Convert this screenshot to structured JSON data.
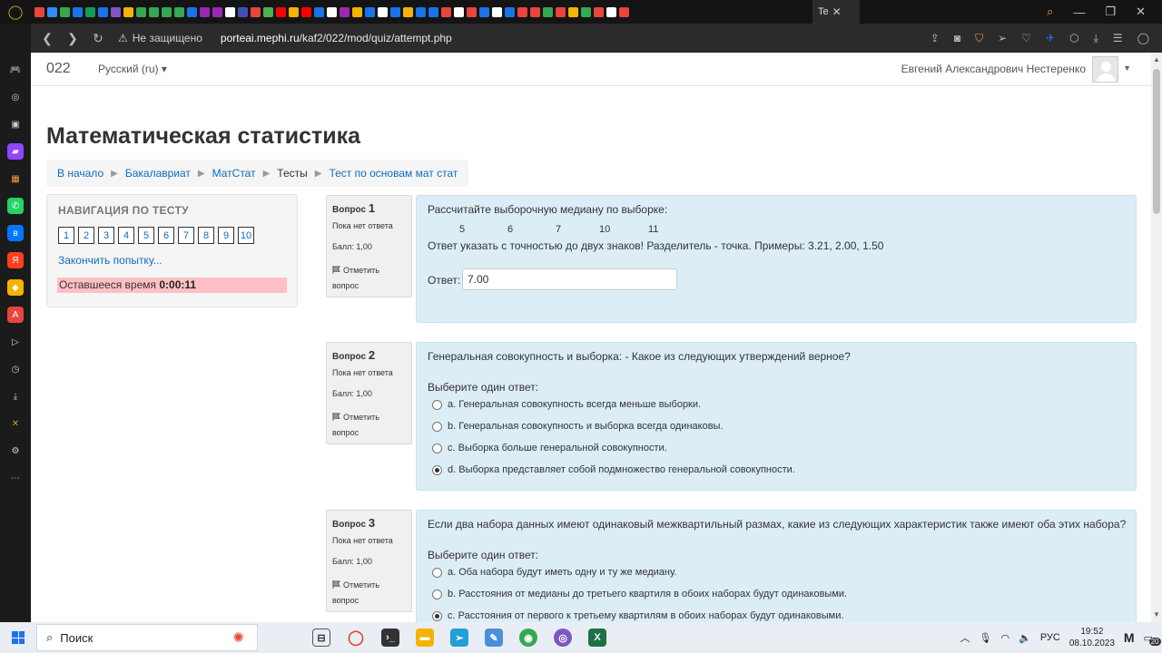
{
  "browser": {
    "active_tab_title": "Te",
    "security_label": "Не защищено",
    "url_host": "porteai.mephi.ru",
    "url_path": "/kaf2/022/mod/quiz/attempt.php"
  },
  "site": {
    "brand": "022",
    "language": "Русский ‎(ru)‎",
    "user_name": "Евгений Александрович Нестеренко"
  },
  "page": {
    "title": "Математическая статистика",
    "breadcrumbs": [
      "В начало",
      "Бакалавриат",
      "МатСтат",
      "Тесты",
      "Тест по основам мат стат"
    ]
  },
  "quiz_nav": {
    "title": "НАВИГАЦИЯ ПО ТЕСТУ",
    "buttons": [
      "1",
      "2",
      "3",
      "4",
      "5",
      "6",
      "7",
      "8",
      "9",
      "10"
    ],
    "finish_link": "Закончить попытку...",
    "timer_label": "Оставшееся время",
    "timer_value": "0:00:11"
  },
  "questions": [
    {
      "label": "Вопрос",
      "number": "1",
      "state": "Пока нет ответа",
      "grade": "Балл: 1,00",
      "flag_label": "Отметить вопрос",
      "text": "Рассчитайте выборочную медиану по выборке:",
      "sample": [
        "5",
        "6",
        "7",
        "10",
        "11"
      ],
      "hint": "Ответ указать с точностью до двух знаков! Разделитель - точка. Примеры: 3.21, 2.00, 1.50",
      "answer_label": "Ответ:",
      "answer_value": "7.00"
    },
    {
      "label": "Вопрос",
      "number": "2",
      "state": "Пока нет ответа",
      "grade": "Балл: 1,00",
      "flag_label": "Отметить вопрос",
      "text": "Генеральная совокупность и выборка: - Какое из следующих утверждений верное?",
      "prompt": "Выберите один ответ:",
      "options": [
        {
          "text": "a. Генеральная совокупность всегда меньше выборки.",
          "checked": false
        },
        {
          "text": "b. Генеральная совокупность и выборка всегда одинаковы.",
          "checked": false
        },
        {
          "text": "c. Выборка больше генеральной совокупности.",
          "checked": false
        },
        {
          "text": "d. Выборка представляет собой подмножество генеральной совокупности.",
          "checked": true
        }
      ]
    },
    {
      "label": "Вопрос",
      "number": "3",
      "state": "Пока нет ответа",
      "grade": "Балл: 1,00",
      "flag_label": "Отметить вопрос",
      "text": "Если два набора данных имеют одинаковый межквартильный размах, какие из следующих характеристик также имеют оба этих набора?",
      "prompt": "Выберите один ответ:",
      "options": [
        {
          "text": "a. Оба набора будут иметь одну и ту же медиану.",
          "checked": false
        },
        {
          "text": "b. Расстояния от медианы до третьего квартиля в обоих наборах будут одинаковыми.",
          "checked": false
        },
        {
          "text": "c. Расстояния от первого к третьему квартилям в обоих наборах будут одинаковыми.",
          "checked": true
        }
      ]
    }
  ],
  "taskbar": {
    "search_label": "Поиск",
    "language": "РУС",
    "time": "19:52",
    "date": "08.10.2023",
    "notifications": "20"
  }
}
